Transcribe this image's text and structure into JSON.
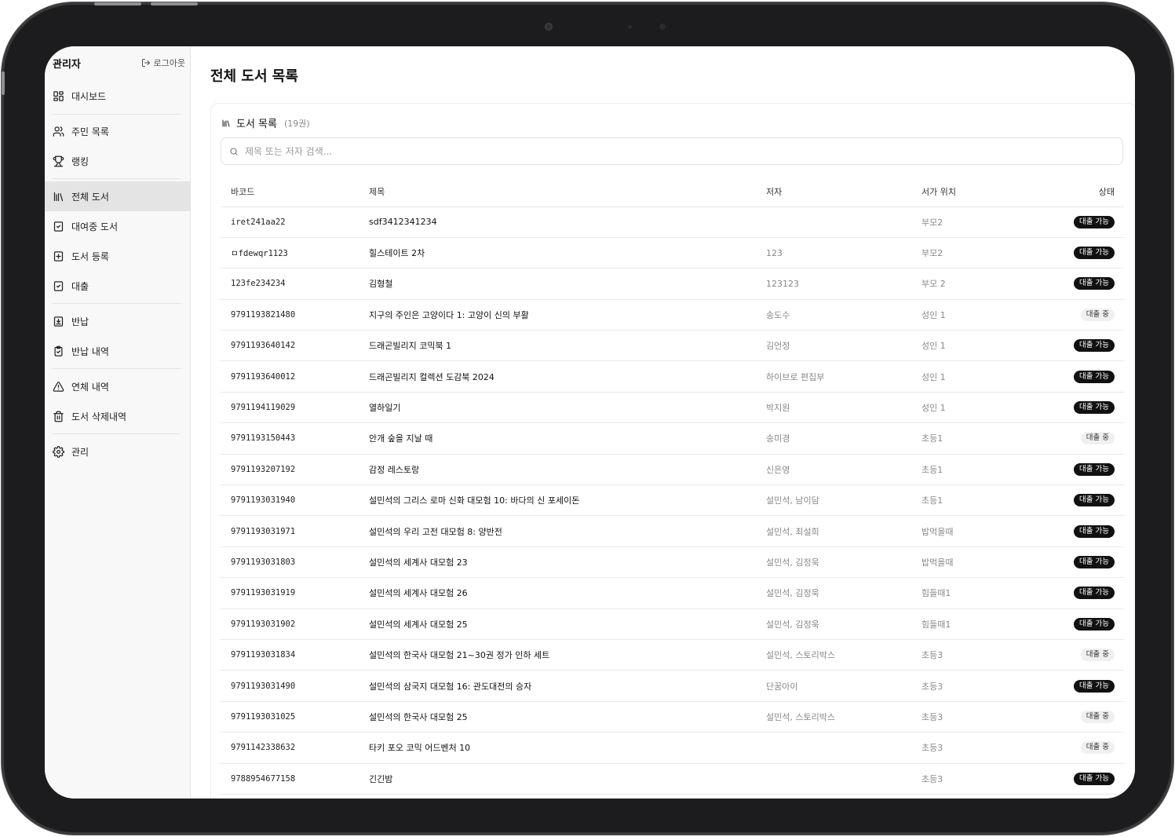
{
  "sidebar": {
    "title": "관리자",
    "logout_label": "로그아웃",
    "items": [
      {
        "label": "대시보드",
        "icon": "dashboard-icon"
      },
      {
        "label": "주민 목록",
        "icon": "users-icon"
      },
      {
        "label": "랭킹",
        "icon": "trophy-icon"
      },
      {
        "label": "전체 도서",
        "icon": "library-icon",
        "active": true
      },
      {
        "label": "대여중 도서",
        "icon": "clipboard-check-icon"
      },
      {
        "label": "도서 등록",
        "icon": "square-plus-icon"
      },
      {
        "label": "대출",
        "icon": "clipboard-check-icon"
      },
      {
        "label": "반납",
        "icon": "square-download-icon"
      },
      {
        "label": "반납 내역",
        "icon": "clipboard-list-icon"
      },
      {
        "label": "연체 내역",
        "icon": "warning-icon"
      },
      {
        "label": "도서 삭제내역",
        "icon": "trash-icon"
      },
      {
        "label": "관리",
        "icon": "gear-icon"
      }
    ]
  },
  "main": {
    "page_title": "전체 도서 목록",
    "card_title": "도서 목록",
    "count_label": "(19권)",
    "search_placeholder": "제목 또는 저자 검색...",
    "columns": [
      "바코드",
      "제목",
      "저자",
      "서가 위치",
      "상태"
    ],
    "rows": [
      {
        "barcode": "iret241aa22",
        "title": "sdf3412341234",
        "author": "",
        "shelf": "부모2",
        "status": "대출 가능"
      },
      {
        "barcode": "ㅁfdewqr1123",
        "title": "힐스테이트 2차",
        "author": "123",
        "shelf": "부모2",
        "status": "대출 가능"
      },
      {
        "barcode": "123fe234234",
        "title": "김형철",
        "author": "123123",
        "shelf": "부모 2",
        "status": "대출 가능"
      },
      {
        "barcode": "9791193821480",
        "title": "지구의 주인은 고양이다 1: 고양이 신의 부활",
        "author": "송도수",
        "shelf": "성인 1",
        "status": "대출 중"
      },
      {
        "barcode": "9791193640142",
        "title": "드래곤빌리지 코믹북 1",
        "author": "김언정",
        "shelf": "성인 1",
        "status": "대출 가능"
      },
      {
        "barcode": "9791193640012",
        "title": "드래곤빌리지 컬렉션 도감북 2024",
        "author": "하이브로 편집부",
        "shelf": "성인 1",
        "status": "대출 가능"
      },
      {
        "barcode": "9791194119029",
        "title": "열하일기",
        "author": "박지원",
        "shelf": "성인 1",
        "status": "대출 가능"
      },
      {
        "barcode": "9791193150443",
        "title": "안개 숲을 지날 때",
        "author": "송미경",
        "shelf": "초등1",
        "status": "대출 중"
      },
      {
        "barcode": "9791193207192",
        "title": "감정 레스토랑",
        "author": "신은영",
        "shelf": "초등1",
        "status": "대출 가능"
      },
      {
        "barcode": "9791193031940",
        "title": "설민석의 그리스 로마 신화 대모험 10: 바다의 신 포세이돈",
        "author": "설민석, 남이담",
        "shelf": "초등1",
        "status": "대출 가능"
      },
      {
        "barcode": "9791193031971",
        "title": "설민석의 우리 고전 대모험 8: 양반전",
        "author": "설민석, 최설희",
        "shelf": "밥먹을때",
        "status": "대출 가능"
      },
      {
        "barcode": "9791193031803",
        "title": "설민석의 세계사 대모험 23",
        "author": "설민석, 김정욱",
        "shelf": "밥먹을때",
        "status": "대출 가능"
      },
      {
        "barcode": "9791193031919",
        "title": "설민석의 세계사 대모험 26",
        "author": "설민석, 김정욱",
        "shelf": "힘들때1",
        "status": "대출 가능"
      },
      {
        "barcode": "9791193031902",
        "title": "설민석의 세계사 대모험 25",
        "author": "설민석, 김정욱",
        "shelf": "힘들때1",
        "status": "대출 가능"
      },
      {
        "barcode": "9791193031834",
        "title": "설민석의 한국사 대모험 21~30권 정가 인하 세트",
        "author": "설민석, 스토리박스",
        "shelf": "초등3",
        "status": "대출 중"
      },
      {
        "barcode": "9791193031490",
        "title": "설민석의 삼국지 대모험 16: 관도대전의 승자",
        "author": "단꿈아이",
        "shelf": "초등3",
        "status": "대출 가능"
      },
      {
        "barcode": "9791193031025",
        "title": "설민석의 한국사 대모험 25",
        "author": "설민석, 스토리박스",
        "shelf": "초등3",
        "status": "대출 중"
      },
      {
        "barcode": "9791142338632",
        "title": "타키 포오 코믹 어드벤처 10",
        "author": "",
        "shelf": "초등3",
        "status": "대출 중"
      },
      {
        "barcode": "9788954677158",
        "title": "긴긴밤",
        "author": "",
        "shelf": "초등3",
        "status": "대출 가능"
      }
    ]
  },
  "colors": {
    "available_badge": "#111111",
    "loaned_badge": "#f0f0f0",
    "active_nav": "#e4e4e4"
  }
}
